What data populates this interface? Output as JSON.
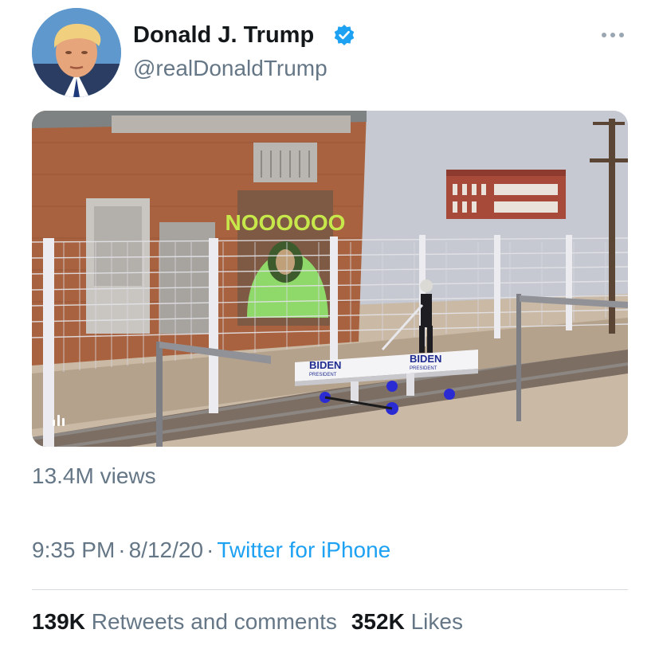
{
  "author": {
    "display_name": "Donald J. Trump",
    "handle": "@realDonaldTrump",
    "verified_icon": "verified-badge-icon",
    "more_icon": "more-options-icon"
  },
  "media": {
    "mural_text": "NOOOOOO",
    "sign_left": "BIDEN",
    "sign_left_sub": "PRESIDENT",
    "sign_right": "BIDEN",
    "sign_right_sub": "PRESIDENT",
    "media_type_icon": "video-stats-icon"
  },
  "views": "13.4M views",
  "meta": {
    "time": "9:35 PM",
    "separator": "·",
    "date": "8/12/20",
    "source": "Twitter for iPhone"
  },
  "stats": {
    "retweets_count": "139K",
    "retweets_label": "Retweets and comments",
    "likes_count": "352K",
    "likes_label": "Likes"
  },
  "colors": {
    "link": "#1da1f2",
    "secondary_text": "#657786",
    "primary_text": "#14171a",
    "verified": "#1da1f2"
  }
}
